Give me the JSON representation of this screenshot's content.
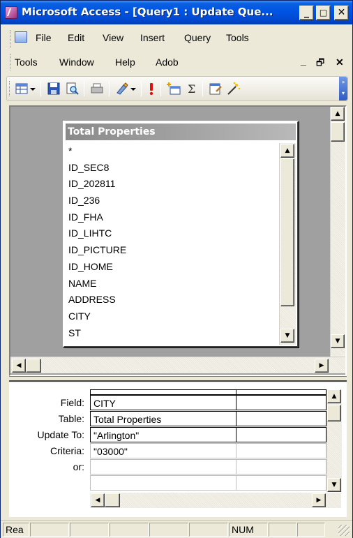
{
  "window": {
    "title": "Microsoft Access - [Query1 : Update Que...",
    "minimize": "_",
    "maximize": "□",
    "close": "✕"
  },
  "menu": {
    "row1": [
      "File",
      "Edit",
      "View",
      "Insert",
      "Query",
      "Tools"
    ],
    "row2": [
      "Tools",
      "Window",
      "Help",
      "Adob"
    ],
    "doc_min": "_",
    "doc_restore": "🗗",
    "doc_close": "✕"
  },
  "toolbar": {
    "icons": [
      "query-type-view-icon",
      "dropdown-arrow-icon",
      "save-icon",
      "print-preview-icon",
      "print-icon",
      "query-type-icon",
      "dropdown-arrow-icon",
      "run-icon",
      "show-table-icon",
      "totals-icon",
      "properties-icon",
      "build-icon",
      "toolbar-options-icon"
    ]
  },
  "table": {
    "title": "Total Properties",
    "fields": [
      "*",
      "ID_SEC8",
      "ID_202811",
      "ID_236",
      "ID_FHA",
      "ID_LIHTC",
      "ID_PICTURE",
      "ID_HOME",
      "NAME",
      "ADDRESS",
      "CITY",
      "ST"
    ]
  },
  "grid": {
    "row_labels": [
      "Field:",
      "Table:",
      "Update To:",
      "Criteria:",
      "or:"
    ],
    "column1": [
      "CITY",
      "Total Properties",
      "\"Arlington\"",
      "\"03000\"",
      ""
    ]
  },
  "status": {
    "ready": "Rea",
    "num": "NUM"
  },
  "colors": {
    "titlebar_blue": "#0054E3",
    "face": "#ECE9D8",
    "workspace_gray": "#A0A0A0"
  }
}
